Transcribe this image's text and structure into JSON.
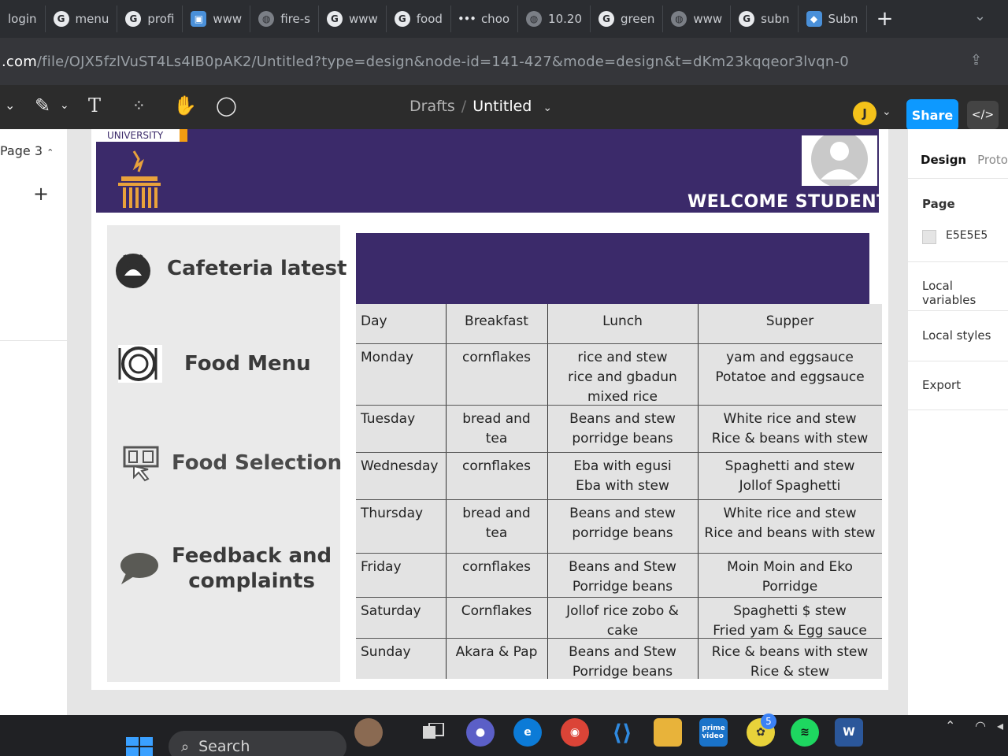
{
  "browser": {
    "tabs": [
      {
        "label": "login",
        "icon": "page-icon"
      },
      {
        "label": "menu",
        "icon": "google-icon"
      },
      {
        "label": "profi",
        "icon": "google-icon"
      },
      {
        "label": "www",
        "icon": "image-icon"
      },
      {
        "label": "fire-s",
        "icon": "globe-icon"
      },
      {
        "label": "www",
        "icon": "google-icon"
      },
      {
        "label": "food",
        "icon": "google-icon"
      },
      {
        "label": "choo",
        "icon": "dots-icon"
      },
      {
        "label": "10.20",
        "icon": "globe-icon"
      },
      {
        "label": "green",
        "icon": "google-icon"
      },
      {
        "label": "www",
        "icon": "globe-icon"
      },
      {
        "label": "subn",
        "icon": "google-icon"
      },
      {
        "label": "Subn",
        "icon": "vue-icon"
      }
    ],
    "new_tab_label": "+",
    "url_host": ".com",
    "url_path": "/file/OJX5fzlVuST4Ls4IB0pAK2/Untitled?type=design&node-id=141-427&mode=design&t=dKm23kqqeor3lvqn-0"
  },
  "figma": {
    "breadcrumb_drafts": "Drafts",
    "breadcrumb_sep": "/",
    "file_name": "Untitled",
    "avatar_initial": "J",
    "share_label": "Share",
    "code_label": "</>",
    "page_label": "Page 3",
    "add_page": "+"
  },
  "right_panel": {
    "tab_design": "Design",
    "tab_prototype": "Prototy",
    "page_heading": "Page",
    "page_color": "E5E5E5",
    "local_variables": "Local variables",
    "local_styles": "Local styles",
    "export": "Export"
  },
  "design": {
    "university_label": "UNIVERSITY",
    "welcome": "WELCOME STUDENT",
    "menu": [
      {
        "label": "Cafeteria latest",
        "icon": "cafeteria-icon"
      },
      {
        "label": "Food Menu",
        "icon": "food-plate-icon"
      },
      {
        "label": "Food Selection",
        "icon": "selection-icon"
      },
      {
        "label": "Feedback and\ncomplaints",
        "icon": "chat-bubble-icon"
      }
    ],
    "table": {
      "headers": [
        "Day",
        "Breakfast",
        "Lunch",
        "Supper"
      ],
      "rows": [
        {
          "day": "Monday",
          "breakfast": "cornflakes",
          "lunch": "rice and stew\nrice and gbadun\nmixed rice",
          "supper": "yam and eggsauce\nPotatoe and eggsauce"
        },
        {
          "day": "Tuesday",
          "breakfast": "bread and tea",
          "lunch": "Beans and stew\nporridge beans",
          "supper": "White rice and stew\nRice & beans with stew"
        },
        {
          "day": "Wednesday",
          "breakfast": "cornflakes",
          "lunch": "Eba with egusi\nEba with stew",
          "supper": "Spaghetti and stew\nJollof Spaghetti"
        },
        {
          "day": "Thursday",
          "breakfast": "bread and tea",
          "lunch": "Beans and stew\nporridge beans",
          "supper": "White rice and stew\nRice and beans with stew"
        },
        {
          "day": "Friday",
          "breakfast": "cornflakes",
          "lunch": "Beans and Stew\nPorridge beans",
          "supper": "Moin Moin and Eko\nPorridge"
        },
        {
          "day": "Saturday",
          "breakfast": "Cornflakes",
          "lunch": "Jollof rice zobo &\ncake",
          "supper": "Spaghetti $ stew\nFried yam & Egg sauce"
        },
        {
          "day": "Sunday",
          "breakfast": "Akara & Pap",
          "lunch": "Beans and Stew\nPorridge beans",
          "supper": "Rice & beans with stew\nRice & stew"
        }
      ]
    }
  },
  "taskbar": {
    "search_label": "Search",
    "notification_count": "5",
    "word_letter": "W"
  },
  "colors": {
    "header_purple": "#3b2a6a",
    "canvas": "#e5e5e5",
    "share_blue": "#0d99ff"
  }
}
